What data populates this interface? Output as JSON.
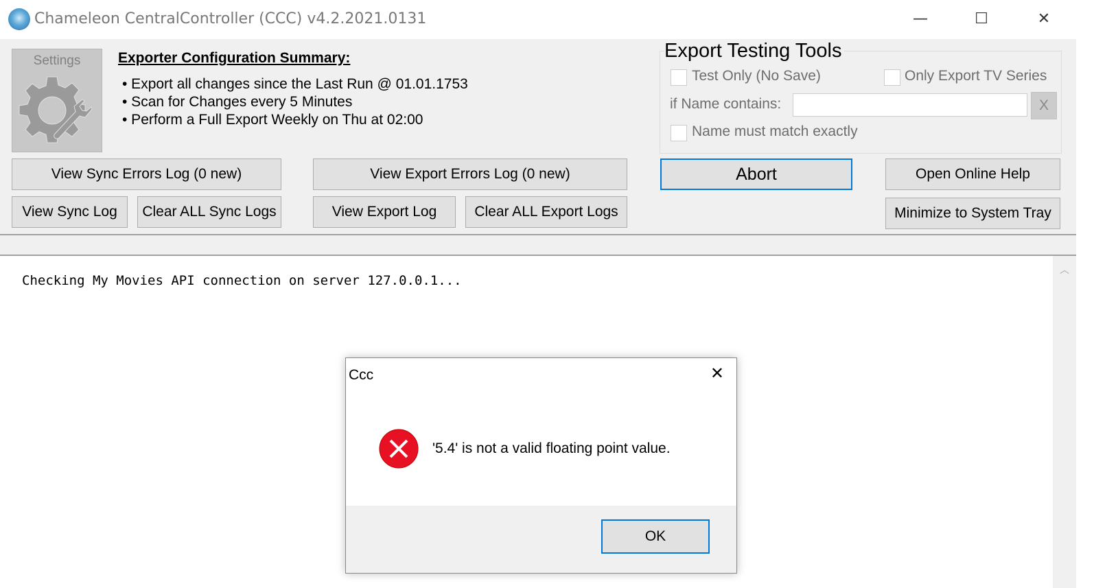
{
  "window": {
    "title": "Chameleon CentralController (CCC) v4.2.2021.0131",
    "minimize": "—",
    "maximize": "☐",
    "close": "✕"
  },
  "settings": {
    "label": "Settings",
    "icon": "gear-wrench-icon"
  },
  "summary": {
    "title": "Exporter Configuration Summary:",
    "items": [
      "• Export all changes since the Last Run @ 01.01.1753",
      "• Scan for Changes every 5 Minutes",
      "• Perform a Full Export Weekly on Thu at 02:00"
    ]
  },
  "buttons": {
    "sync_errors": "View Sync Errors Log (0 new)",
    "export_errors": "View Export Errors Log (0 new)",
    "abort": "Abort",
    "help": "Open Online Help",
    "sync_log": "View Sync Log",
    "clear_sync": "Clear ALL Sync Logs",
    "export_log": "View Export Log",
    "clear_export": "Clear ALL Export Logs",
    "tray": "Minimize to System Tray"
  },
  "testing": {
    "title": "Export Testing Tools",
    "test_only": "Test Only (No Save)",
    "tv_only": "Only Export TV Series",
    "name_contains": "if Name contains:",
    "name_value": "",
    "clear": "X",
    "exact": "Name must match exactly"
  },
  "log": {
    "lines": [
      "Checking My Movies API connection on server 127.0.0.1..."
    ]
  },
  "dialog": {
    "title": "Ccc",
    "message": "'5.4' is not a valid floating point value.",
    "ok": "OK",
    "close": "✕",
    "icon": "error-icon",
    "accent": "#0078d7",
    "error_color": "#e81123"
  }
}
